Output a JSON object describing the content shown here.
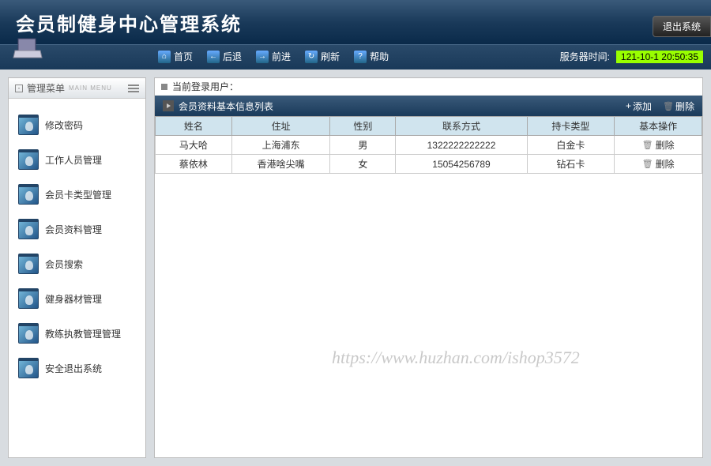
{
  "header": {
    "title": "会员制健身中心管理系统",
    "exit_label": "退出系统"
  },
  "toolbar": {
    "items": [
      {
        "label": "首页",
        "glyph": "⌂"
      },
      {
        "label": "后退",
        "glyph": "←"
      },
      {
        "label": "前进",
        "glyph": "→"
      },
      {
        "label": "刷新",
        "glyph": "↻"
      },
      {
        "label": "帮助",
        "glyph": "?"
      }
    ],
    "server_label": "服务器时间:",
    "server_time": "121-10-1 20:50:35"
  },
  "sidebar": {
    "header": "管理菜单",
    "sub": "MAIN MENU",
    "items": [
      {
        "label": "修改密码"
      },
      {
        "label": "工作人员管理"
      },
      {
        "label": "会员卡类型管理"
      },
      {
        "label": "会员资料管理"
      },
      {
        "label": "会员搜索"
      },
      {
        "label": "健身器材管理"
      },
      {
        "label": "教练执教管理管理"
      },
      {
        "label": "安全退出系统"
      }
    ]
  },
  "content": {
    "current_user_label": "当前登录用户：",
    "list_title": "会员资料基本信息列表",
    "add_label": "添加",
    "delete_all_label": "删除",
    "columns": {
      "name": "姓名",
      "address": "住址",
      "gender": "性别",
      "contact": "联系方式",
      "card_type": "持卡类型",
      "op": "基本操作"
    },
    "rows": [
      {
        "name": "马大哈",
        "address": "上海浦东",
        "gender": "男",
        "contact": "1322222222222",
        "card_type": "白金卡",
        "op": "删除"
      },
      {
        "name": "蔡依林",
        "address": "香港啥尖嘴",
        "gender": "女",
        "contact": "15054256789",
        "card_type": "钻石卡",
        "op": "删除"
      }
    ]
  },
  "watermark": "https://www.huzhan.com/ishop3572"
}
